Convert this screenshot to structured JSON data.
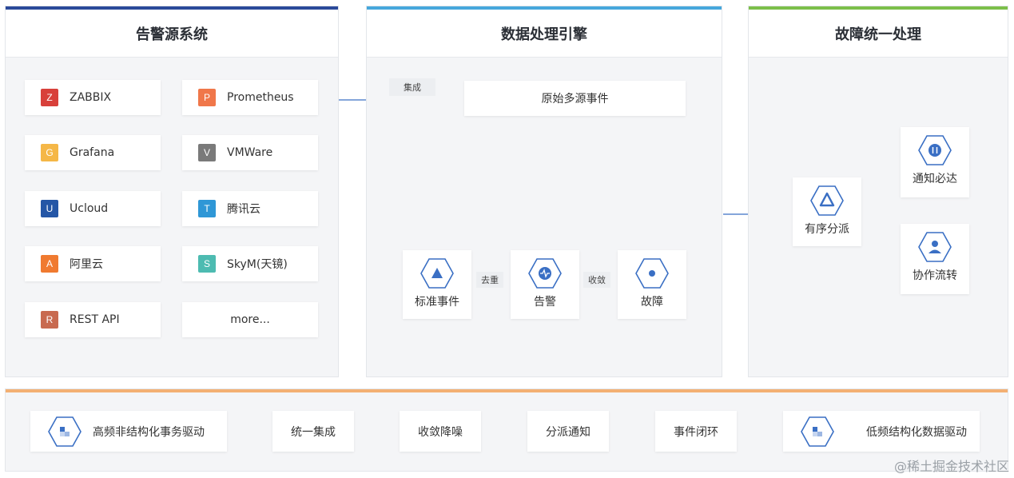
{
  "panels": {
    "alert_source": {
      "title": "告警源系统",
      "accent": "#2b4a9a"
    },
    "processing": {
      "title": "数据处理引擎",
      "accent": "#46a7dc"
    },
    "fault": {
      "title": "故障统一处理",
      "accent": "#7cbf4a"
    }
  },
  "sources": [
    {
      "letter": "Z",
      "label": "ZABBIX",
      "color": "#d8403a"
    },
    {
      "letter": "P",
      "label": "Prometheus",
      "color": "#f0774a"
    },
    {
      "letter": "G",
      "label": "Grafana",
      "color": "#f5b747"
    },
    {
      "letter": "V",
      "label": "VMWare",
      "color": "#7a7a7a"
    },
    {
      "letter": "U",
      "label": "Ucloud",
      "color": "#2456a6"
    },
    {
      "letter": "T",
      "label": "腾讯云",
      "color": "#2f97d6"
    },
    {
      "letter": "A",
      "label": "阿里云",
      "color": "#f07a30"
    },
    {
      "letter": "S",
      "label": "SkyM(天镜)",
      "color": "#4dbbb1"
    },
    {
      "letter": "R",
      "label": "REST API",
      "color": "#c86a50"
    }
  ],
  "more_label": "more...",
  "processing": {
    "integrate_tag": "集成",
    "raw_events": "原始多源事件",
    "standard_event": "标准事件",
    "dedupe_tag": "去重",
    "alert": "告警",
    "converge_tag": "收敛",
    "fault": "故障"
  },
  "fault_handling": {
    "dispatch": "有序分派",
    "notify": "通知必达",
    "collab": "协作流转"
  },
  "bottom_flow": {
    "accent": "#f3b073",
    "steps": [
      "高频非结构化事务驱动",
      "统一集成",
      "收敛降噪",
      "分派通知",
      "事件闭环",
      "低频结构化数据驱动"
    ]
  },
  "watermark": "@稀土掘金技术社区"
}
